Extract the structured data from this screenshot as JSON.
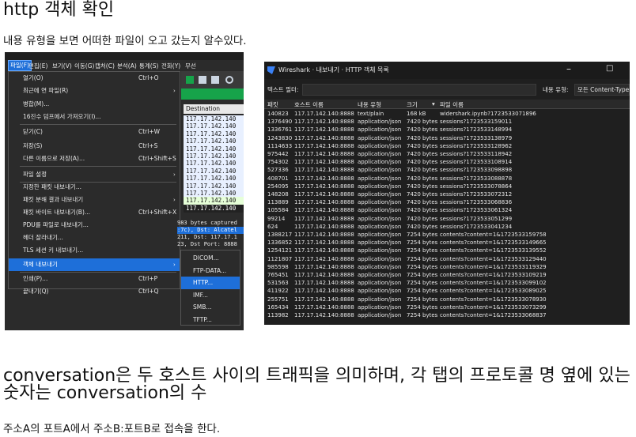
{
  "doc": {
    "heading1": "http 객체 확인",
    "para1": "내용 유형을 보면 어떠한 파일이 오고 갔는지 알수있다.",
    "heading2": "conversation은 두 호스트 사이의 트래픽을 의미하며, 각 탭의 프로토콜 명 옆에 있는 숫자는 conversation의 수",
    "para2": "주소A의 포트A에서 주소B:포트B로 접속을 한다."
  },
  "wireshark_menu": {
    "menubar": [
      "파일(F)",
      "편집(E)",
      "보기(V)",
      "이동(G)",
      "캡처(C)",
      "분석(A)",
      "통계(S)",
      "전화(Y)",
      "무선"
    ],
    "items": [
      {
        "label": "열기(O)",
        "shortcut": "Ctrl+O",
        "sub": false
      },
      {
        "label": "최근에 연 파일(R)",
        "shortcut": "",
        "sub": true
      },
      {
        "label": "병합(M)...",
        "shortcut": "",
        "sub": false
      },
      {
        "label": "16진수 덤프에서 가져오기(I)...",
        "shortcut": "",
        "sub": false
      },
      {
        "label": "닫기(C)",
        "shortcut": "Ctrl+W",
        "sub": false
      },
      {
        "label": "저장(S)",
        "shortcut": "Ctrl+S",
        "sub": false
      },
      {
        "label": "다른 이름으로 저장(A)...",
        "shortcut": "Ctrl+Shift+S",
        "sub": false
      },
      {
        "label": "파일 설정",
        "shortcut": "",
        "sub": true
      },
      {
        "label": "지정한 패킷 내보내기...",
        "shortcut": "",
        "sub": false
      },
      {
        "label": "패킷 분해 결과 내보내기",
        "shortcut": "",
        "sub": true
      },
      {
        "label": "패킷 바이트 내보내기(B)...",
        "shortcut": "Ctrl+Shift+X",
        "sub": false
      },
      {
        "label": "PDU를 파일로 내보내기...",
        "shortcut": "",
        "sub": false
      },
      {
        "label": "헤더 잘라내기...",
        "shortcut": "",
        "sub": false
      },
      {
        "label": "TLS 세션 키 내보내기...",
        "shortcut": "",
        "sub": false
      },
      {
        "label": "객체 내보내기",
        "shortcut": "",
        "sub": true
      },
      {
        "label": "인쇄(P)...",
        "shortcut": "Ctrl+P",
        "sub": false
      },
      {
        "label": "끝내기(Q)",
        "shortcut": "Ctrl+Q",
        "sub": false
      }
    ],
    "submenu": [
      "DICOM...",
      "FTP-DATA...",
      "HTTP...",
      "IMF...",
      "SMB...",
      "TFTP..."
    ],
    "destination_header": "Destination",
    "destinations": [
      "117.17.142.140",
      "117.17.142.140",
      "117.17.142.140",
      "117.17.142.140",
      "117.17.142.140",
      "117.17.142.140",
      "117.17.142.140",
      "117.17.142.140",
      "117.17.142.140",
      "117.17.142.140",
      "117.17.142.140",
      "117.17.142.140",
      "117.17.142.140"
    ],
    "details": [
      "983 bytes captured",
      ":7c), Dst: Alcatel",
      "211, Dst: 117.17.1",
      "23, Dst Port: 8888"
    ]
  },
  "export_window": {
    "title": "Wireshark · 내보내기 · HTTP 객체 목록",
    "filter_label": "텍스트 필터:",
    "content_type_label": "내용 유형:",
    "content_type_value": "모든 Content-Types",
    "columns": [
      "패킷",
      "호스트 이름",
      "내용 유형",
      "크기",
      "파일 이름"
    ],
    "rows": [
      [
        "140823",
        "117.17.142.140:8888",
        "text/plain",
        "168 kB",
        "widershark.ipynb?1723533071896"
      ],
      [
        "1376490",
        "117.17.142.140:8888",
        "application/json",
        "7420 bytes",
        "sessions?1723533159011"
      ],
      [
        "1336761",
        "117.17.142.140:8888",
        "application/json",
        "7420 bytes",
        "sessions?1723533148994"
      ],
      [
        "1243830",
        "117.17.142.140:8888",
        "application/json",
        "7420 bytes",
        "sessions?1723533138979"
      ],
      [
        "1114633",
        "117.17.142.140:8888",
        "application/json",
        "7420 bytes",
        "sessions?1723533128962"
      ],
      [
        "975442",
        "117.17.142.140:8888",
        "application/json",
        "7420 bytes",
        "sessions?1723533118942"
      ],
      [
        "754302",
        "117.17.142.140:8888",
        "application/json",
        "7420 bytes",
        "sessions?1723533108914"
      ],
      [
        "527336",
        "117.17.142.140:8888",
        "application/json",
        "7420 bytes",
        "sessions?1723533098898"
      ],
      [
        "408701",
        "117.17.142.140:8888",
        "application/json",
        "7420 bytes",
        "sessions?1723533088878"
      ],
      [
        "254095",
        "117.17.142.140:8888",
        "application/json",
        "7420 bytes",
        "sessions?1723533078864"
      ],
      [
        "148208",
        "117.17.142.140:8888",
        "application/json",
        "7420 bytes",
        "sessions?1723533072312"
      ],
      [
        "113889",
        "117.17.142.140:8888",
        "application/json",
        "7420 bytes",
        "sessions?1723533068836"
      ],
      [
        "105584",
        "117.17.142.140:8888",
        "application/json",
        "7420 bytes",
        "sessions?1723533061324"
      ],
      [
        "99214",
        "117.17.142.140:8888",
        "application/json",
        "7420 bytes",
        "sessions?1723533051299"
      ],
      [
        "624",
        "117.17.142.140:8888",
        "application/json",
        "7420 bytes",
        "sessions?1723533041234"
      ],
      [
        "1388217",
        "117.17.142.140:8888",
        "application/json",
        "7254 bytes",
        "contents?content=1&1723533159758"
      ],
      [
        "1336852",
        "117.17.142.140:8888",
        "application/json",
        "7254 bytes",
        "contents?content=1&1723533149665"
      ],
      [
        "1254121",
        "117.17.142.140:8888",
        "application/json",
        "7254 bytes",
        "contents?content=1&1723533139552"
      ],
      [
        "1121807",
        "117.17.142.140:8888",
        "application/json",
        "7254 bytes",
        "contents?content=1&1723533129440"
      ],
      [
        "985598",
        "117.17.142.140:8888",
        "application/json",
        "7254 bytes",
        "contents?content=1&1723533119329"
      ],
      [
        "765451",
        "117.17.142.140:8888",
        "application/json",
        "7254 bytes",
        "contents?content=1&1723533109219"
      ],
      [
        "531563",
        "117.17.142.140:8888",
        "application/json",
        "7254 bytes",
        "contents?content=1&1723533099102"
      ],
      [
        "411922",
        "117.17.142.140:8888",
        "application/json",
        "7254 bytes",
        "contents?content=1&1723533089025"
      ],
      [
        "255751",
        "117.17.142.140:8888",
        "application/json",
        "7254 bytes",
        "contents?content=1&1723533078930"
      ],
      [
        "165434",
        "117.17.142.140:8888",
        "application/json",
        "7254 bytes",
        "contents?content=1&1723533073299"
      ],
      [
        "113982",
        "117.17.142.140:8888",
        "application/json",
        "7254 bytes",
        "contents?content=1&1723533068837"
      ]
    ]
  }
}
